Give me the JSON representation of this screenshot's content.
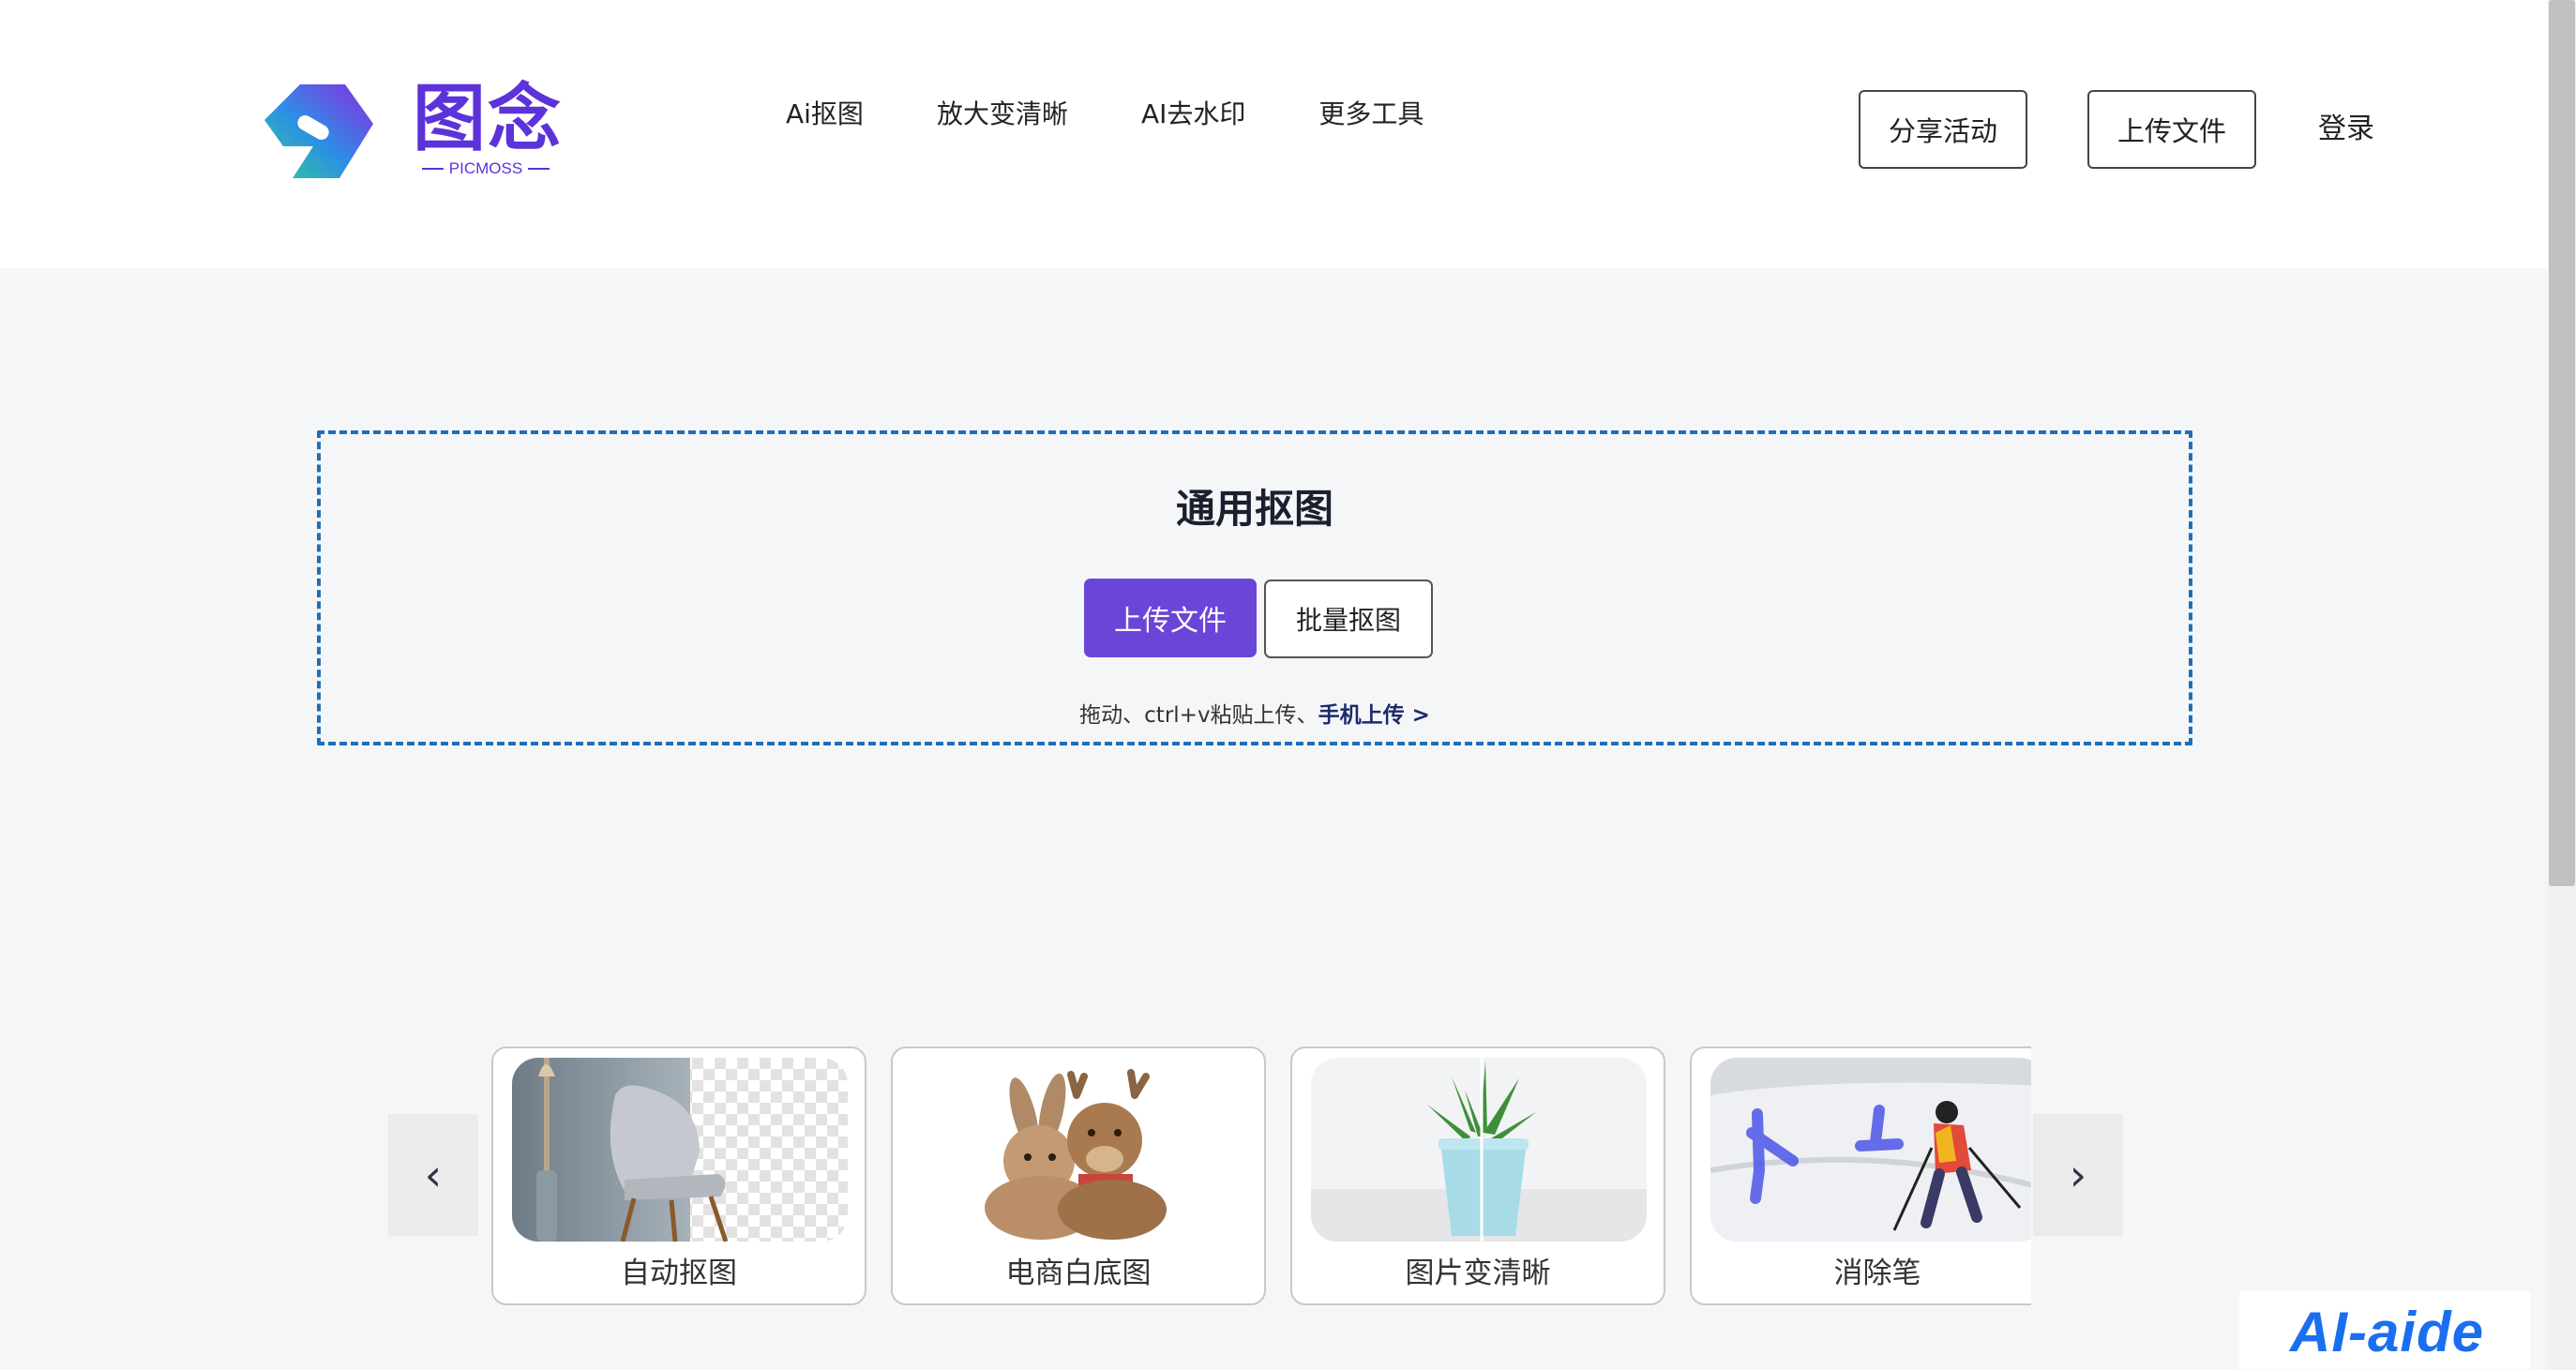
{
  "header": {
    "logo": {
      "text_cn": "图念",
      "text_en": "PICMOSS"
    },
    "nav": [
      "Ai抠图",
      "放大变清晰",
      "AI去水印",
      "更多工具"
    ],
    "share_button": "分享活动",
    "upload_button": "上传文件",
    "login_label": "登录"
  },
  "upload_area": {
    "title": "通用抠图",
    "upload_button": "上传文件",
    "batch_button": "批量抠图",
    "hint": "拖动、ctrl+v粘贴上传、",
    "mobile_link": "手机上传 >"
  },
  "carousel": {
    "prev": "‹",
    "next": "›",
    "cards": [
      {
        "label": "自动抠图",
        "icon": "chair-photo"
      },
      {
        "label": "电商白底图",
        "icon": "plush-toys-photo"
      },
      {
        "label": "图片变清晰",
        "icon": "succulent-pot-photo"
      },
      {
        "label": "消除笔",
        "icon": "skiers-photo"
      }
    ]
  },
  "watermark": "AI-aide",
  "colors": {
    "brand": "#5c33d9",
    "primary_button": "#6a45d8",
    "dashed_border": "#1f6fb8",
    "watermark": "#1a6ff0"
  }
}
